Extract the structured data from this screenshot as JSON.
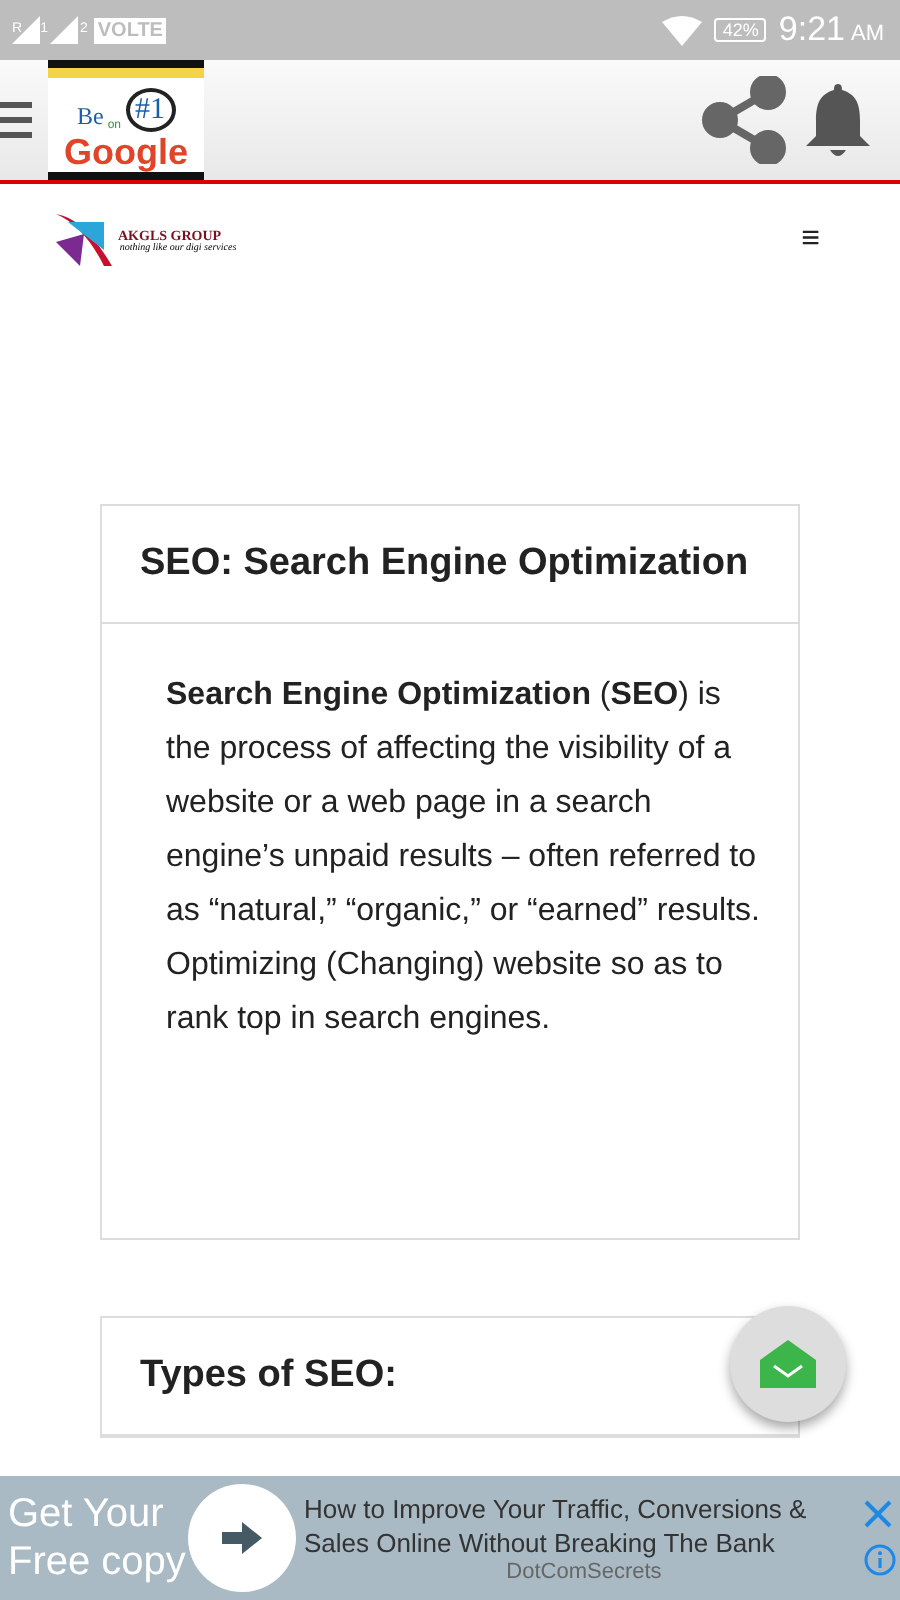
{
  "status_bar": {
    "sim_labels": [
      "R",
      "1",
      "2"
    ],
    "network": "VOLTE",
    "battery": "42%",
    "time": "9:21",
    "ampm": "AM"
  },
  "app_bar": {
    "logo": {
      "line1": "Be",
      "number": "#1",
      "on": "on",
      "brand": "Google"
    }
  },
  "site_header": {
    "logo": {
      "name": "AKGLS GROUP",
      "tagline": "nothing like our digi services"
    },
    "menu": "≡"
  },
  "cards": [
    {
      "title": "SEO: Search Engine Optimization",
      "body": "**Search Engine Optimization** (**SEO**) is the process of affecting the visibility of a website or a web page in a search engine’s unpaid results – often referred to as “natural,” “organic,” or “earned” results. Optimizing (Changing) website so as to rank top in search engines."
    },
    {
      "title": "Types of SEO:"
    }
  ],
  "ad": {
    "cta": "Get Your Free copy",
    "headline": "How to Improve Your Traffic, Conversions & Sales Online Without Breaking The Bank",
    "advertiser": "DotComSecrets"
  }
}
